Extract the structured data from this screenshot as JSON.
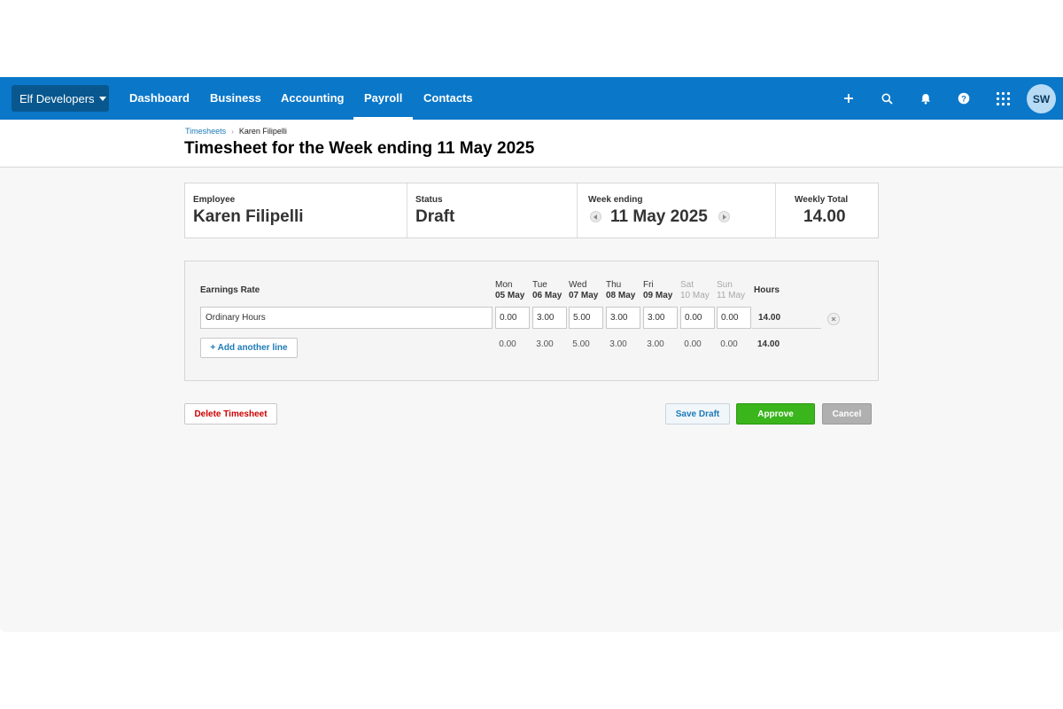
{
  "nav": {
    "org_name": "Elf Developers",
    "links": [
      "Dashboard",
      "Business",
      "Accounting",
      "Payroll",
      "Contacts"
    ],
    "active": "Payroll",
    "icons": [
      "plus-icon",
      "search-icon",
      "bell-icon",
      "help-icon",
      "apps-grid-icon"
    ],
    "avatar_initials": "SW"
  },
  "breadcrumb": {
    "parent": "Timesheets",
    "current": "Karen Filipelli"
  },
  "page_title": "Timesheet for the Week ending 11 May 2025",
  "summary": {
    "employee_label": "Employee",
    "employee": "Karen Filipelli",
    "status_label": "Status",
    "status": "Draft",
    "week_label": "Week ending",
    "week_ending": "11 May 2025",
    "total_label": "Weekly Total",
    "total": "14.00"
  },
  "grid": {
    "earnings_rate_label": "Earnings Rate",
    "hours_label": "Hours",
    "days": [
      {
        "day": "Mon",
        "date": "05 May"
      },
      {
        "day": "Tue",
        "date": "06 May"
      },
      {
        "day": "Wed",
        "date": "07 May"
      },
      {
        "day": "Thu",
        "date": "08 May"
      },
      {
        "day": "Fri",
        "date": "09 May"
      },
      {
        "day": "Sat",
        "date": "10 May"
      },
      {
        "day": "Sun",
        "date": "11 May"
      }
    ],
    "row": {
      "rate": "Ordinary Hours",
      "hours": [
        "0.00",
        "3.00",
        "5.00",
        "3.00",
        "3.00",
        "0.00",
        "0.00"
      ],
      "total": "14.00"
    },
    "add_line_label": "+ Add another line",
    "footer_totals": [
      "0.00",
      "3.00",
      "5.00",
      "3.00",
      "3.00",
      "0.00",
      "0.00"
    ],
    "footer_total": "14.00"
  },
  "actions": {
    "delete": "Delete Timesheet",
    "save": "Save Draft",
    "approve": "Approve",
    "cancel": "Cancel"
  },
  "colors": {
    "nav_bg": "#0a77c9",
    "approve": "#3ab51c",
    "delete_text": "#cc0000",
    "link": "#1d7ab8"
  }
}
